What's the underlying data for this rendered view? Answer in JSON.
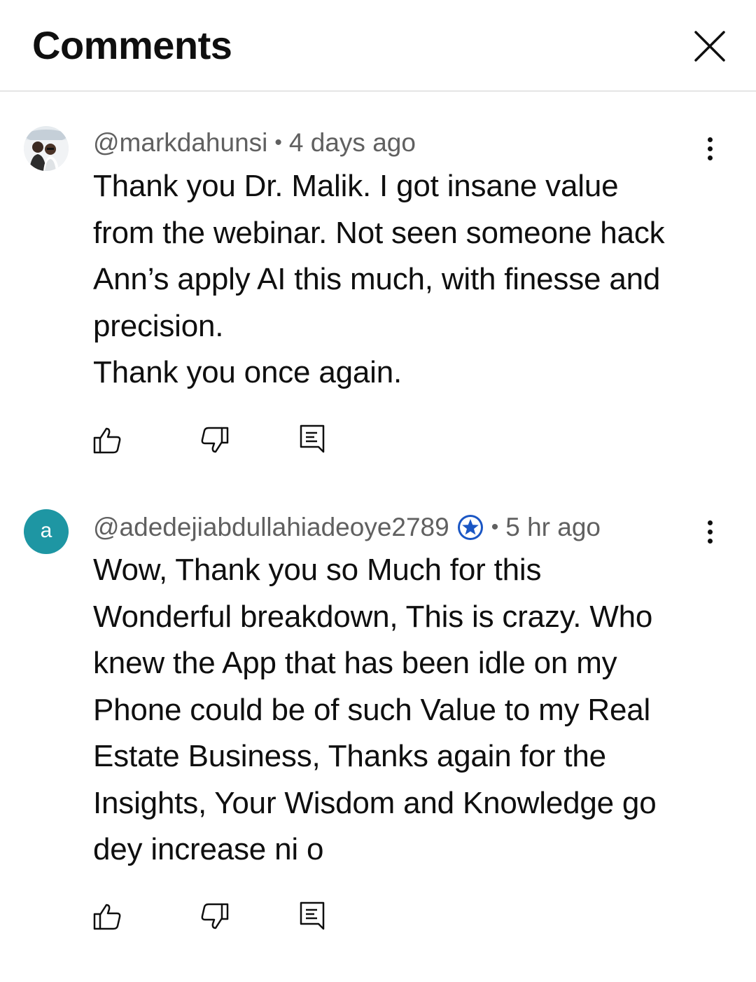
{
  "header": {
    "title": "Comments"
  },
  "comments": [
    {
      "author": "@markdahunsi",
      "separator": "•",
      "time": "4 days ago",
      "avatar": "photo",
      "verified": false,
      "text": "Thank you Dr. Malik. I got insane value\nfrom the webinar. Not seen someone hack\nAnn’s apply AI this much, with finesse and\nprecision.\nThank you once again."
    },
    {
      "author": "@adedejiabdullahiadeoye2789",
      "separator": "•",
      "time": "5 hr ago",
      "avatar_letter": "a",
      "avatar_color": "#1e96a3",
      "verified": true,
      "text": "Wow, Thank you so Much for this\nWonderful breakdown, This is crazy. Who\nknew the App that has been idle on my\nPhone could be of such Value to my Real\nEstate Business, Thanks again for the\nInsights, Your Wisdom and Knowledge go\ndey increase ni o"
    }
  ],
  "icons": {
    "close": "close-icon",
    "more": "more-vert-icon",
    "like": "thumbs-up-icon",
    "dislike": "thumbs-down-icon",
    "reply": "reply-icon",
    "badge": "star-badge-icon"
  },
  "colors": {
    "text": "#0f0f0f",
    "meta": "#606060",
    "avatar": "#1e96a3",
    "badge": "#1a56c4",
    "divider": "#e5e5e5"
  }
}
